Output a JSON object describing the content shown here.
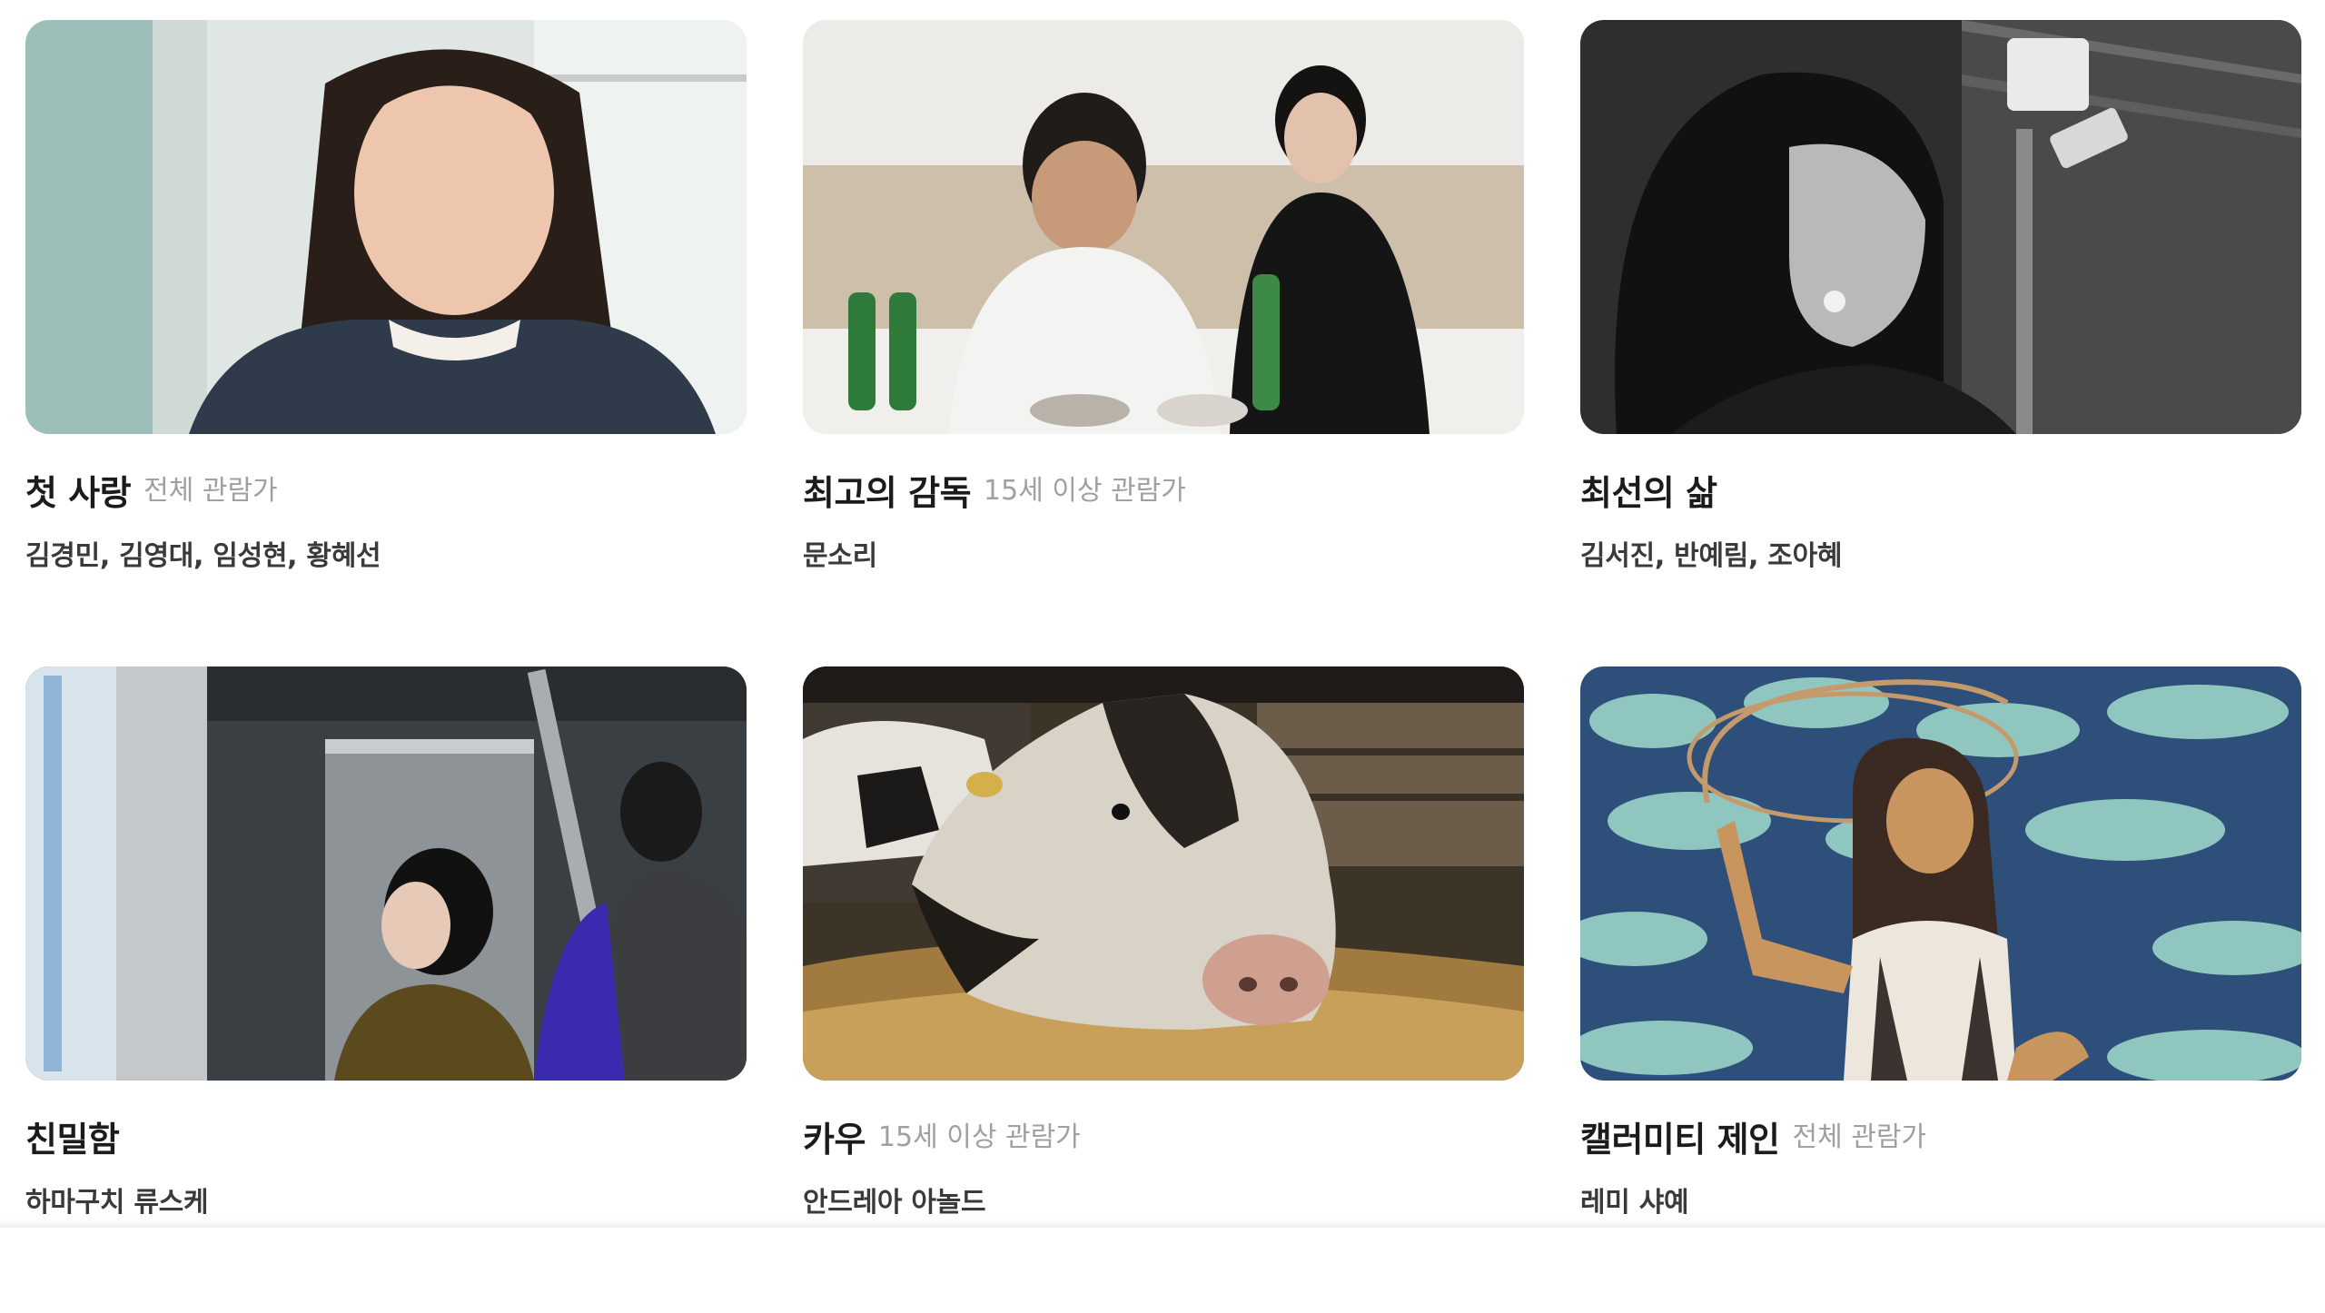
{
  "movies": [
    {
      "title": "첫 사랑",
      "rating": "전체 관람가",
      "cast": "김경민, 김영대, 임성현, 황혜선"
    },
    {
      "title": "최고의 감독",
      "rating": "15세 이상 관람가",
      "cast": "문소리"
    },
    {
      "title": "최선의 삶",
      "rating": "",
      "cast": "김서진, 반예림, 조아혜"
    },
    {
      "title": "친밀함",
      "rating": "",
      "cast": "하마구치 류스케"
    },
    {
      "title": "카우",
      "rating": "15세 이상 관람가",
      "cast": "안드레아 아놀드"
    },
    {
      "title": "캘러미티 제인",
      "rating": "전체 관람가",
      "cast": "레미 샤예"
    }
  ]
}
